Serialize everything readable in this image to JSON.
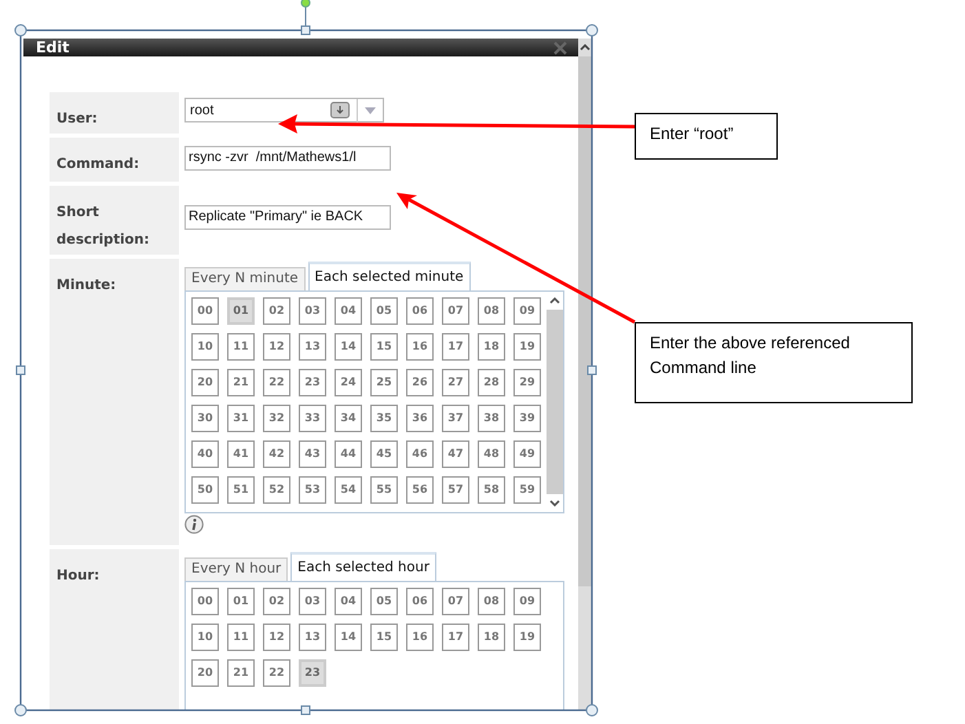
{
  "dialog": {
    "title": "Edit",
    "fields": [
      {
        "label": "User:",
        "value": "root",
        "kind": "combo"
      },
      {
        "label": "Command:",
        "value": "rsync -zvr  /mnt/Mathews1/l",
        "kind": "text"
      },
      {
        "label": "Short description:",
        "value": "Replicate \"Primary\" ie BACK",
        "kind": "text"
      }
    ],
    "schedules": [
      {
        "label": "Minute:",
        "info": true,
        "scrollable": true,
        "tabs": [
          {
            "label": "Every N minute",
            "selected": false
          },
          {
            "label": "Each selected minute",
            "selected": true
          }
        ],
        "values": [
          {
            "label": "00",
            "selected": false
          },
          {
            "label": "01",
            "selected": true
          },
          {
            "label": "02",
            "selected": false
          },
          {
            "label": "03",
            "selected": false
          },
          {
            "label": "04",
            "selected": false
          },
          {
            "label": "05",
            "selected": false
          },
          {
            "label": "06",
            "selected": false
          },
          {
            "label": "07",
            "selected": false
          },
          {
            "label": "08",
            "selected": false
          },
          {
            "label": "09",
            "selected": false
          },
          {
            "label": "10",
            "selected": false
          },
          {
            "label": "11",
            "selected": false
          },
          {
            "label": "12",
            "selected": false
          },
          {
            "label": "13",
            "selected": false
          },
          {
            "label": "14",
            "selected": false
          },
          {
            "label": "15",
            "selected": false
          },
          {
            "label": "16",
            "selected": false
          },
          {
            "label": "17",
            "selected": false
          },
          {
            "label": "18",
            "selected": false
          },
          {
            "label": "19",
            "selected": false
          },
          {
            "label": "20",
            "selected": false
          },
          {
            "label": "21",
            "selected": false
          },
          {
            "label": "22",
            "selected": false
          },
          {
            "label": "23",
            "selected": false
          },
          {
            "label": "24",
            "selected": false
          },
          {
            "label": "25",
            "selected": false
          },
          {
            "label": "26",
            "selected": false
          },
          {
            "label": "27",
            "selected": false
          },
          {
            "label": "28",
            "selected": false
          },
          {
            "label": "29",
            "selected": false
          },
          {
            "label": "30",
            "selected": false
          },
          {
            "label": "31",
            "selected": false
          },
          {
            "label": "32",
            "selected": false
          },
          {
            "label": "33",
            "selected": false
          },
          {
            "label": "34",
            "selected": false
          },
          {
            "label": "35",
            "selected": false
          },
          {
            "label": "36",
            "selected": false
          },
          {
            "label": "37",
            "selected": false
          },
          {
            "label": "38",
            "selected": false
          },
          {
            "label": "39",
            "selected": false
          },
          {
            "label": "40",
            "selected": false
          },
          {
            "label": "41",
            "selected": false
          },
          {
            "label": "42",
            "selected": false
          },
          {
            "label": "43",
            "selected": false
          },
          {
            "label": "44",
            "selected": false
          },
          {
            "label": "45",
            "selected": false
          },
          {
            "label": "46",
            "selected": false
          },
          {
            "label": "47",
            "selected": false
          },
          {
            "label": "48",
            "selected": false
          },
          {
            "label": "49",
            "selected": false
          },
          {
            "label": "50",
            "selected": false
          },
          {
            "label": "51",
            "selected": false
          },
          {
            "label": "52",
            "selected": false
          },
          {
            "label": "53",
            "selected": false
          },
          {
            "label": "54",
            "selected": false
          },
          {
            "label": "55",
            "selected": false
          },
          {
            "label": "56",
            "selected": false
          },
          {
            "label": "57",
            "selected": false
          },
          {
            "label": "58",
            "selected": false
          },
          {
            "label": "59",
            "selected": false
          }
        ]
      },
      {
        "label": "Hour:",
        "info": false,
        "scrollable": false,
        "tabs": [
          {
            "label": "Every N hour",
            "selected": false
          },
          {
            "label": "Each selected hour",
            "selected": true
          }
        ],
        "values": [
          {
            "label": "00",
            "selected": false
          },
          {
            "label": "01",
            "selected": false
          },
          {
            "label": "02",
            "selected": false
          },
          {
            "label": "03",
            "selected": false
          },
          {
            "label": "04",
            "selected": false
          },
          {
            "label": "05",
            "selected": false
          },
          {
            "label": "06",
            "selected": false
          },
          {
            "label": "07",
            "selected": false
          },
          {
            "label": "08",
            "selected": false
          },
          {
            "label": "09",
            "selected": false
          },
          {
            "label": "10",
            "selected": false
          },
          {
            "label": "11",
            "selected": false
          },
          {
            "label": "12",
            "selected": false
          },
          {
            "label": "13",
            "selected": false
          },
          {
            "label": "14",
            "selected": false
          },
          {
            "label": "15",
            "selected": false
          },
          {
            "label": "16",
            "selected": false
          },
          {
            "label": "17",
            "selected": false
          },
          {
            "label": "18",
            "selected": false
          },
          {
            "label": "19",
            "selected": false
          },
          {
            "label": "20",
            "selected": false
          },
          {
            "label": "21",
            "selected": false
          },
          {
            "label": "22",
            "selected": false
          },
          {
            "label": "23",
            "selected": true
          }
        ]
      }
    ]
  },
  "callouts": [
    {
      "text": "Enter “root”"
    },
    {
      "text": "Enter the above referenced Command line"
    }
  ]
}
